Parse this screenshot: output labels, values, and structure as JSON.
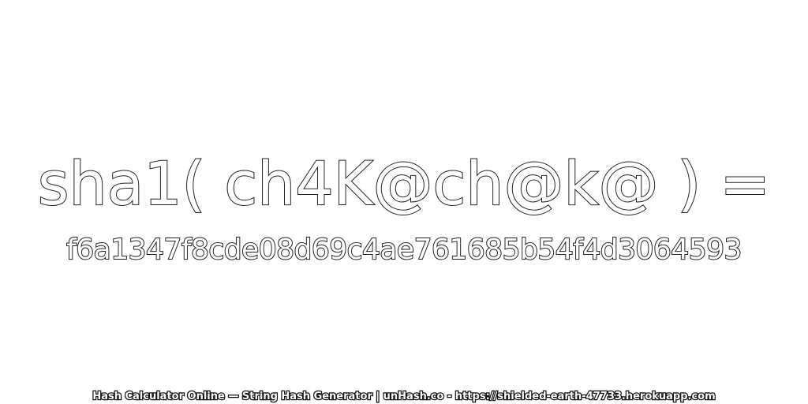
{
  "expression": "sha1( ch4K@ch@k@ ) =",
  "hash": "f6a1347f8cde08d69c4ae761685b54f4d3064593",
  "footer": "Hash Calculator Online — String Hash Generator | unHash.co - https://shielded-earth-47733.herokuapp.com",
  "colors": {
    "background": "#ffffff",
    "text_fill": "#ffffff",
    "text_outline": "#222222"
  }
}
